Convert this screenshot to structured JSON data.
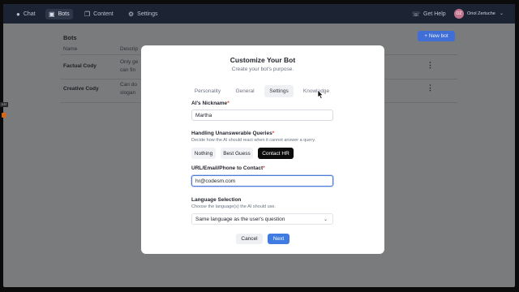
{
  "nav": {
    "items": [
      {
        "label": "Chat",
        "icon": "chat-icon"
      },
      {
        "label": "Bots",
        "icon": "bot-icon"
      },
      {
        "label": "Content",
        "icon": "content-icon"
      },
      {
        "label": "Settings",
        "icon": "gear-icon"
      }
    ],
    "help_label": "Get Help",
    "user_initials": "OZ",
    "user_name": "Oriol Zertuche"
  },
  "page": {
    "title": "Bots",
    "new_button": "+ New bot",
    "columns": [
      "Name",
      "Descrip"
    ],
    "bots": [
      {
        "name": "Factual Cody",
        "desc_lines": [
          "Only ge",
          "can fin"
        ]
      },
      {
        "name": "Creative Cody",
        "desc_lines": [
          "Can do",
          "slogan"
        ]
      }
    ]
  },
  "side": {
    "badge": "2:37"
  },
  "modal": {
    "title": "Customize Your Bot",
    "subtitle": "Create your bot's purpose.",
    "tabs": [
      "Personality",
      "General",
      "Settings",
      "Knowledge"
    ],
    "nickname": {
      "label": "AI's Nickname",
      "value": "Martha"
    },
    "unanswerable": {
      "label": "Handling Unanswerable Queries",
      "help": "Decide how the AI should react when it cannot answer a query.",
      "options": [
        "Nothing",
        "Best Guess",
        "Contact HR"
      ],
      "selected": "Contact HR"
    },
    "contact": {
      "label": "URL/Email/Phone to Contact",
      "value": "hr@codesm.com"
    },
    "language": {
      "label": "Language Selection",
      "help": "Choose the language(s) the AI should use.",
      "value": "Same language as the user's question"
    },
    "cancel_label": "Cancel",
    "next_label": "Next"
  },
  "colors": {
    "accent": "#3f7be0",
    "required": "#e0453b",
    "topbar": "#1c2433"
  }
}
